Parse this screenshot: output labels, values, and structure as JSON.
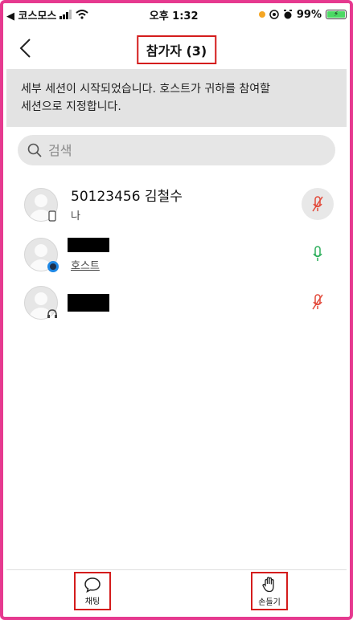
{
  "status_bar": {
    "carrier": "◀ 코스모스",
    "time": "오후 1:32",
    "battery": "99%"
  },
  "header": {
    "title": "참가자 (3)"
  },
  "banner": {
    "line1": "세부 세션이 시작되었습니다. 호스트가 귀하를 참여할",
    "line2": "세션으로 지정합니다."
  },
  "search": {
    "placeholder": "검색"
  },
  "participants": [
    {
      "name": "50123456 김철수",
      "role": "나",
      "mic": "muted"
    },
    {
      "name": "",
      "role": "호스트",
      "mic": "on"
    },
    {
      "name": "",
      "role": "",
      "mic": "muted"
    }
  ],
  "bottom_bar": {
    "chat_label": "채팅",
    "raise_hand_label": "손들기"
  },
  "colors": {
    "frame": "#e6398f",
    "highlight": "#d41c1c",
    "mic_on": "#2eaf5c",
    "mic_muted": "#e24a3b",
    "banner_bg": "#e3e3e3"
  }
}
